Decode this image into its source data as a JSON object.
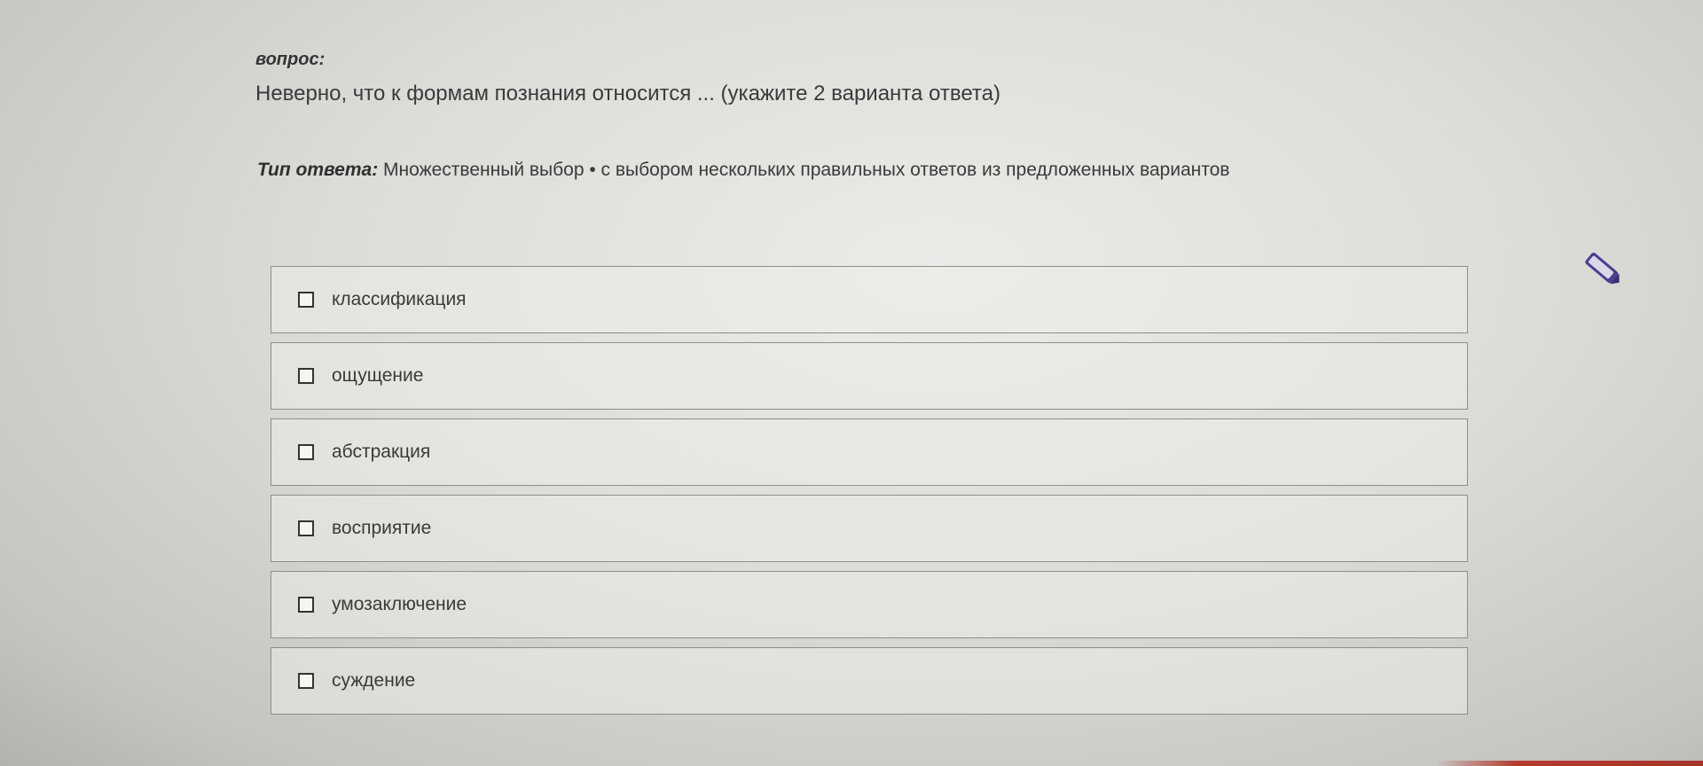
{
  "question": {
    "label": "вопрос:",
    "text": "Неверно, что к формам познания относится ... (укажите 2 варианта ответа)"
  },
  "answer_type": {
    "label": "Тип ответа:",
    "value": "Множественный выбор • с выбором нескольких правильных ответов из предложенных вариантов"
  },
  "options": [
    {
      "label": "классификация",
      "checked": false
    },
    {
      "label": "ощущение",
      "checked": false
    },
    {
      "label": "абстракция",
      "checked": false
    },
    {
      "label": "восприятие",
      "checked": false
    },
    {
      "label": "умозаключение",
      "checked": false
    },
    {
      "label": "суждение",
      "checked": false
    }
  ],
  "icons": {
    "side_tool": "pencil-icon"
  },
  "colors": {
    "border": "#8e8e8a",
    "text": "#3a3a3a",
    "tool_icon": "#4a3f8f"
  }
}
